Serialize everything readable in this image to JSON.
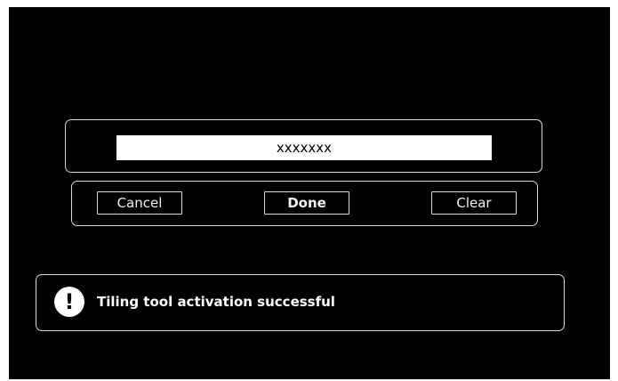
{
  "input": {
    "value": "xxxxxxx"
  },
  "buttons": {
    "cancel_label": "Cancel",
    "done_label": "Done",
    "clear_label": "Clear"
  },
  "notification": {
    "icon": "exclamation-icon",
    "message": "Tiling tool activation successful"
  },
  "colors": {
    "background": "#000000",
    "foreground": "#ffffff",
    "border": "#d9d9d9"
  }
}
